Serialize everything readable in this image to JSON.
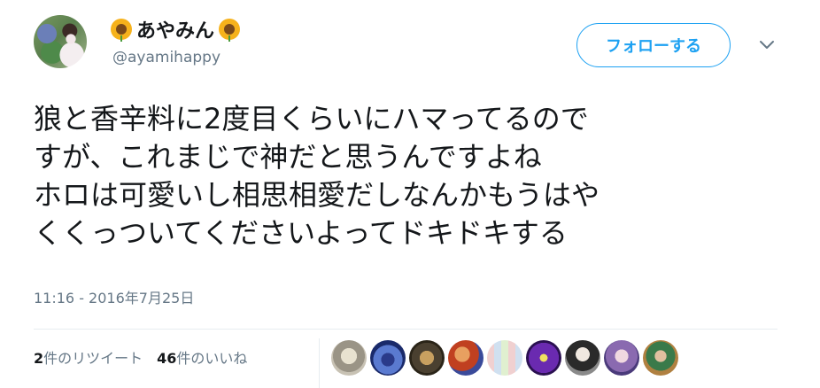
{
  "user": {
    "display_name": "あやみん",
    "handle": "@ayamihappy"
  },
  "follow_button": {
    "label": "フォローする"
  },
  "tweet": {
    "lines": [
      "狼と香辛料に2度目くらいにハマってるので",
      "すが、これまじで神だと思うんですよね",
      "ホロは可愛いし相思相愛だしなんかもうはや",
      "くくっついてくださいよってドキドキする"
    ],
    "timestamp": "11:16 - 2016年7月25日"
  },
  "stats": {
    "retweets_count": "2",
    "retweets_label": "件のリツイート",
    "likes_count": "46",
    "likes_label": "件のいいね"
  },
  "icons": {
    "name_decoration": "sunflower-icon",
    "menu": "chevron-down-icon"
  },
  "colors": {
    "accent": "#1da1f2",
    "secondary_text": "#657786",
    "primary_text": "#14171a"
  }
}
